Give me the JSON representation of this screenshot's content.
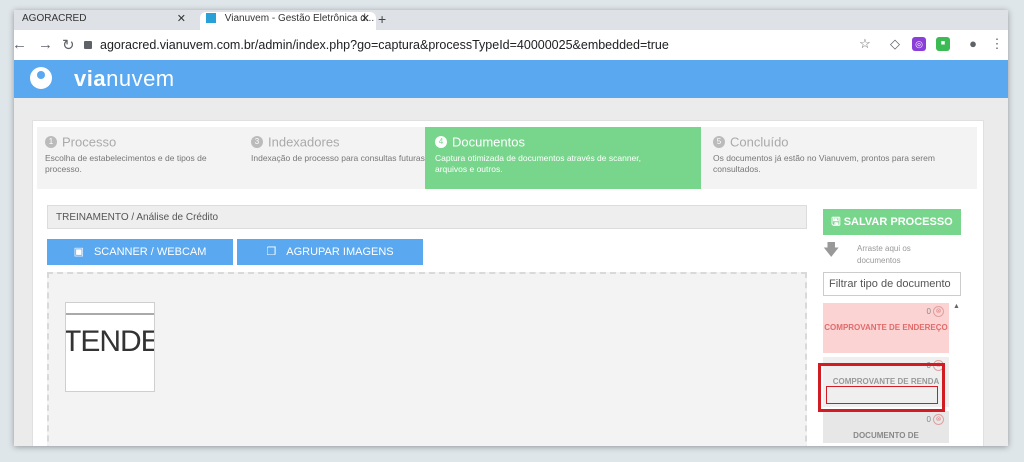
{
  "browser": {
    "tabs": [
      {
        "title": "AGORACRED"
      },
      {
        "title": "Vianuvem - Gestão Eletrônica d..."
      }
    ],
    "url": "agoracred.vianuvem.com.br/admin/index.php?go=captura&processTypeId=40000025&embedded=true"
  },
  "app": {
    "brand_bold": "via",
    "brand_rest": "nuvem"
  },
  "steps": [
    {
      "number": "1",
      "title": "Processo",
      "description": "Escolha de estabelecimentos e de tipos de processo."
    },
    {
      "number": "3",
      "title": "Indexadores",
      "description": "Indexação de processo para consultas futuras."
    },
    {
      "number": "4",
      "title": "Documentos",
      "description": "Captura otimizada de documentos através de scanner, arquivos e outros."
    },
    {
      "number": "5",
      "title": "Concluído",
      "description": "Os documentos já estão no Vianuvem, prontos para serem consultados."
    }
  ],
  "breadcrumb": "TREINAMENTO / Análise de Crédito",
  "buttons": {
    "scanner": "SCANNER / WEBCAM",
    "group": "AGRUPAR IMAGENS",
    "save": "SALVAR PROCESSO"
  },
  "thumbnail_text": "TENDE",
  "hint": "Arraste aqui os documentos",
  "filter_placeholder": "Filtrar tipo de documento",
  "documents": [
    {
      "label": "COMPROVANTE DE ENDEREÇO",
      "count": "0"
    },
    {
      "label": "COMPROVANTE DE RENDA",
      "count": "0"
    },
    {
      "label": "DOCUMENTO DE",
      "count": "0"
    }
  ],
  "colors": {
    "accent_blue": "#5aa8f0",
    "accent_green": "#77d68b",
    "highlight_red": "#d01c22"
  }
}
